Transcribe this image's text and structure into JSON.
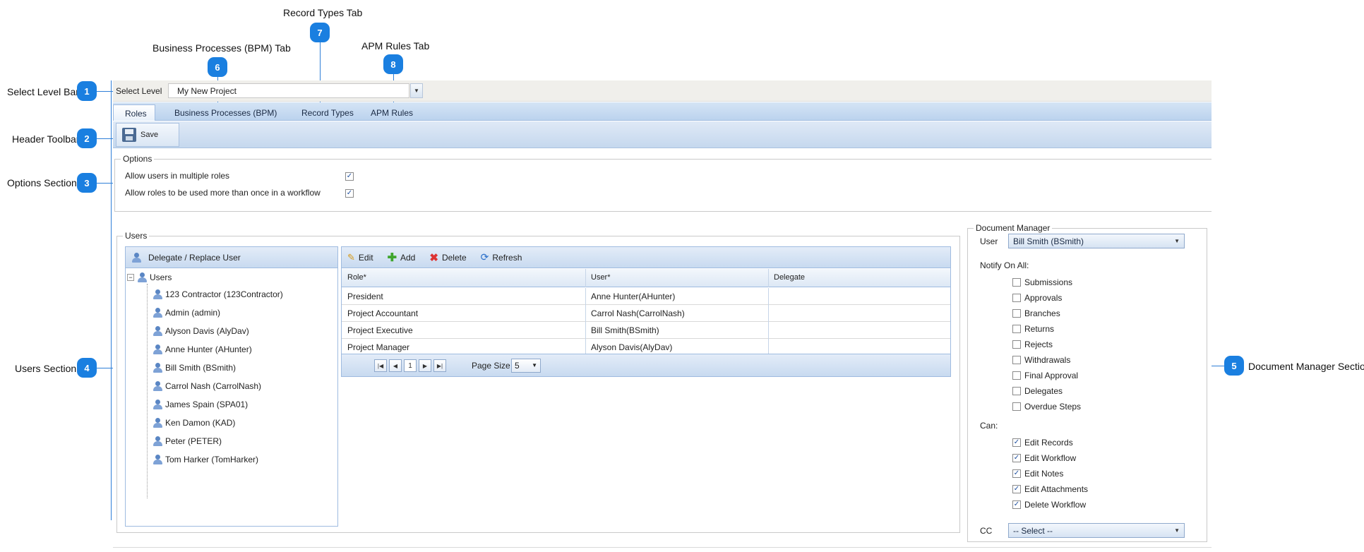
{
  "callouts": {
    "select_level_bar": {
      "label": "Select Level Bar",
      "num": "1"
    },
    "header_toolbar": {
      "label": "Header Toolbar",
      "num": "2"
    },
    "options_section": {
      "label": "Options Section",
      "num": "3"
    },
    "users_section": {
      "label": "Users Section",
      "num": "4"
    },
    "document_manager_section": {
      "label": "Document Manager Section",
      "num": "5"
    },
    "bpm_tab": {
      "label": "Business Processes (BPM) Tab",
      "num": "6"
    },
    "record_types_tab": {
      "label": "Record Types Tab",
      "num": "7"
    },
    "apm_rules_tab": {
      "label": "APM Rules Tab",
      "num": "8"
    }
  },
  "select_level": {
    "label": "Select Level",
    "value": "My New Project"
  },
  "tabs": [
    "Roles",
    "Business Processes (BPM)",
    "Record Types",
    "APM Rules"
  ],
  "toolbar": {
    "save_label": "Save"
  },
  "options": {
    "legend": "Options",
    "items": [
      {
        "label": "Allow users in multiple roles",
        "checked": true
      },
      {
        "label": "Allow roles to be used more than once in a workflow",
        "checked": true
      }
    ]
  },
  "users": {
    "legend": "Users",
    "delegate_button": "Delegate / Replace User",
    "root": "Users",
    "items": [
      "123 Contractor (123Contractor)",
      "Admin (admin)",
      "Alyson Davis (AlyDav)",
      "Anne Hunter (AHunter)",
      "Bill Smith (BSmith)",
      "Carrol Nash (CarrolNash)",
      "James Spain (SPA01)",
      "Ken Damon (KAD)",
      "Peter (PETER)",
      "Tom Harker (TomHarker)"
    ]
  },
  "grid": {
    "toolbar": {
      "edit": "Edit",
      "add": "Add",
      "delete": "Delete",
      "refresh": "Refresh"
    },
    "columns": [
      "Role*",
      "User*",
      "Delegate"
    ],
    "rows": [
      [
        "President",
        "Anne Hunter(AHunter)",
        ""
      ],
      [
        "Project Accountant",
        "Carrol Nash(CarrolNash)",
        ""
      ],
      [
        "Project Executive",
        "Bill Smith(BSmith)",
        ""
      ],
      [
        "Project Manager",
        "Alyson Davis(AlyDav)",
        ""
      ]
    ],
    "pager": {
      "current_page": "1",
      "page_size_label": "Page Size",
      "page_size": "5"
    }
  },
  "document_manager": {
    "legend": "Document Manager",
    "user_label": "User",
    "user_value": "Bill Smith (BSmith)",
    "notify_label": "Notify On All:",
    "notify": [
      {
        "label": "Submissions",
        "checked": false
      },
      {
        "label": "Approvals",
        "checked": false
      },
      {
        "label": "Branches",
        "checked": false
      },
      {
        "label": "Returns",
        "checked": false
      },
      {
        "label": "Rejects",
        "checked": false
      },
      {
        "label": "Withdrawals",
        "checked": false
      },
      {
        "label": "Final Approval",
        "checked": false
      },
      {
        "label": "Delegates",
        "checked": false
      },
      {
        "label": "Overdue Steps",
        "checked": false
      }
    ],
    "can_label": "Can:",
    "can": [
      {
        "label": "Edit Records",
        "checked": true
      },
      {
        "label": "Edit Workflow",
        "checked": true
      },
      {
        "label": "Edit Notes",
        "checked": true
      },
      {
        "label": "Edit Attachments",
        "checked": true
      },
      {
        "label": "Delete Workflow",
        "checked": true
      }
    ],
    "cc_label": "CC",
    "cc_value": "-- Select --"
  },
  "colors": {
    "callout": "#1a7fe0",
    "tab_bg": "#bcd3ee"
  }
}
